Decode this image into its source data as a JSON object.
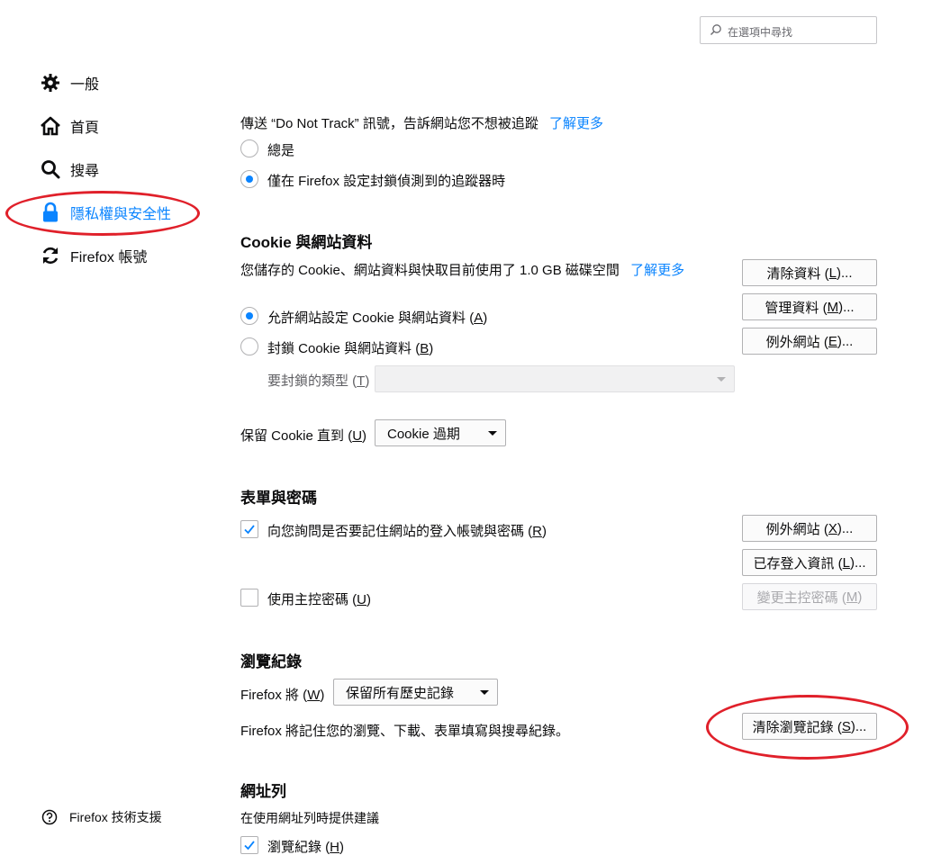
{
  "search": {
    "placeholder": "在選項中尋找"
  },
  "sidebar": {
    "items": [
      {
        "label": "一般",
        "icon": "gear-icon"
      },
      {
        "label": "首頁",
        "icon": "home-icon"
      },
      {
        "label": "搜尋",
        "icon": "search-icon"
      },
      {
        "label": "隱私權與安全性",
        "icon": "lock-icon",
        "selected": true
      },
      {
        "label": "Firefox 帳號",
        "icon": "sync-icon"
      }
    ],
    "support_label": "Firefox 技術支援"
  },
  "dnt": {
    "text": "傳送 “Do Not Track” 訊號，告訴網站您不想被追蹤",
    "learn_more": "了解更多",
    "options": [
      "總是",
      "僅在 Firefox 設定封鎖偵測到的追蹤器時"
    ],
    "selected_index": 1
  },
  "cookies": {
    "heading": "Cookie 與網站資料",
    "usage_text": "您儲存的 Cookie、網站資料與快取目前使用了 1.0 GB 磁碟空間",
    "learn_more": "了解更多",
    "clear_btn": {
      "text": "清除資料 (",
      "key": "L",
      "tail": ")..."
    },
    "manage_btn": {
      "text": "管理資料 (",
      "key": "M",
      "tail": ")..."
    },
    "exceptions_btn": {
      "text": "例外網站 (",
      "key": "E",
      "tail": ")..."
    },
    "allow_option": {
      "text": "允許網站設定 Cookie 與網站資料 (",
      "key": "A",
      "tail": ")"
    },
    "block_option": {
      "text": "封鎖 Cookie 與網站資料 (",
      "key": "B",
      "tail": ")"
    },
    "allow_selected": true,
    "block_type_label": {
      "text": "要封鎖的類型 (",
      "key": "T",
      "tail": ")"
    },
    "block_type_value": "",
    "keep_label": {
      "text": "保留 Cookie 直到 (",
      "key": "U",
      "tail": ")"
    },
    "keep_value": "Cookie 過期"
  },
  "forms": {
    "heading": "表單與密碼",
    "ask_save": {
      "text": "向您詢問是否要記住網站的登入帳號與密碼 (",
      "key": "R",
      "tail": ")",
      "checked": true
    },
    "exceptions_btn": {
      "text": "例外網站 (",
      "key": "X",
      "tail": ")..."
    },
    "saved_logins_btn": {
      "text": "已存登入資訊 (",
      "key": "L",
      "tail": ")..."
    },
    "master_pw": {
      "text": "使用主控密碼 (",
      "key": "U",
      "tail": ")",
      "checked": false
    },
    "change_master_btn": {
      "text": "變更主控密碼 (",
      "key": "M",
      "tail": ")"
    }
  },
  "history": {
    "heading": "瀏覽紀錄",
    "firefox_will": {
      "text": "Firefox 將 (",
      "key": "W",
      "tail": ")"
    },
    "mode_value": "保留所有歷史記錄",
    "description": "Firefox 將記住您的瀏覽、下載、表單填寫與搜尋紀錄。",
    "clear_btn": {
      "text": "清除瀏覽記錄 (",
      "key": "S",
      "tail": ")..."
    }
  },
  "addressbar": {
    "heading": "網址列",
    "subtitle": "在使用網址列時提供建議",
    "browsing": {
      "text": "瀏覽紀錄 (",
      "key": "H",
      "tail": ")",
      "checked": true
    }
  },
  "colors": {
    "accent": "#0a84ff",
    "annotation": "#e0202a"
  }
}
